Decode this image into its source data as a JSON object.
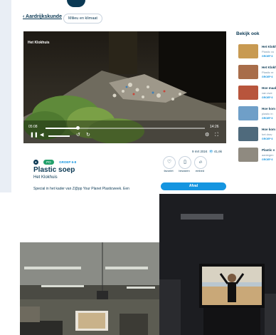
{
  "screen": {
    "breadcrumb": "‹ Aardrijkskunde",
    "chip": "Milieu en klimaat",
    "video": {
      "label": "Het Klokhuis",
      "current_time": "05:08",
      "duration": "14:26",
      "progress_fraction": 0.2
    },
    "badges": [
      {
        "text": "PO",
        "color": "#22a06b"
      },
      {
        "text": "GROEP 6-8",
        "color": "#1595e0"
      }
    ],
    "title": "Plastic soep",
    "subtitle": "Het Klokhuis",
    "description": "Special in het kader van Z@pp Your Planet Plasticweek. Een",
    "date": "9 mrt 2024",
    "views": "41,6k",
    "actions": [
      {
        "icon": "heart-icon",
        "glyph": "♡",
        "label": "favoriet"
      },
      {
        "icon": "bookmark-icon",
        "glyph": "▯",
        "label": "bewaren"
      },
      {
        "icon": "embed-icon",
        "glyph": "‹/›",
        "label": "embed"
      }
    ],
    "afval_button": "Afval",
    "sidebar_title": "Bekijk ook",
    "related": [
      {
        "title": "Het Klokhuis",
        "sub": "Plastic vo",
        "group": "GROEP 6",
        "color": "#c89a52"
      },
      {
        "title": "Het Klokhuis",
        "sub": "Plastic re",
        "group": "GROEP 6",
        "color": "#a86d4a"
      },
      {
        "title": "Hoe maak",
        "sub": "van zwe",
        "group": "GROEP 6",
        "color": "#b8553c"
      },
      {
        "title": "Hoe kom",
        "sub": "plastic in",
        "group": "GROEP 6",
        "color": "#6f9fc8"
      },
      {
        "title": "Hoe kom",
        "sub": "het drav",
        "group": "GROEP 6",
        "color": "#4f6a7c"
      },
      {
        "title": "Plastic v",
        "sub": "aanlegen",
        "group": "GROEP 6",
        "color": "#8f8a80"
      }
    ]
  }
}
